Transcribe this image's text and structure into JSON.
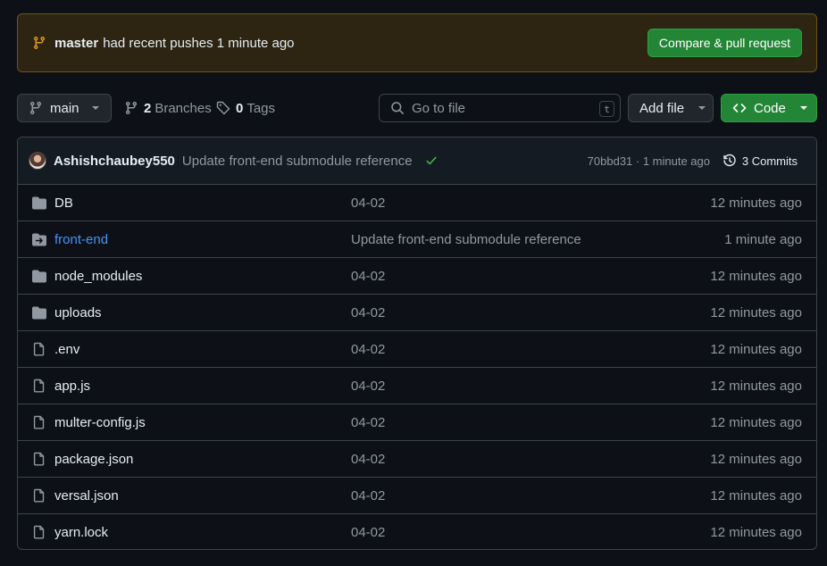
{
  "banner": {
    "branch": "master",
    "message": "had recent pushes 1 minute ago",
    "compare_label": "Compare & pull request"
  },
  "toolbar": {
    "branch_label": "main",
    "branches_count": "2",
    "branches_label": "Branches",
    "tags_count": "0",
    "tags_label": "Tags",
    "search_placeholder": "Go to file",
    "search_shortcut": "t",
    "add_file_label": "Add file",
    "code_label": "Code"
  },
  "commit": {
    "author": "Ashishchaubey550",
    "message": "Update front-end submodule reference",
    "meta": "70bbd31 · 1 minute ago",
    "commits_label": "3 Commits"
  },
  "files": [
    {
      "name": "DB",
      "type": "folder",
      "message": "04-02",
      "date": "12 minutes ago"
    },
    {
      "name": "front-end",
      "type": "submodule",
      "message": "Update front-end submodule reference",
      "date": "1 minute ago"
    },
    {
      "name": "node_modules",
      "type": "folder",
      "message": "04-02",
      "date": "12 minutes ago"
    },
    {
      "name": "uploads",
      "type": "folder",
      "message": "04-02",
      "date": "12 minutes ago"
    },
    {
      "name": ".env",
      "type": "file",
      "message": "04-02",
      "date": "12 minutes ago"
    },
    {
      "name": "app.js",
      "type": "file",
      "message": "04-02",
      "date": "12 minutes ago"
    },
    {
      "name": "multer-config.js",
      "type": "file",
      "message": "04-02",
      "date": "12 minutes ago"
    },
    {
      "name": "package.json",
      "type": "file",
      "message": "04-02",
      "date": "12 minutes ago"
    },
    {
      "name": "versal.json",
      "type": "file",
      "message": "04-02",
      "date": "12 minutes ago"
    },
    {
      "name": "yarn.lock",
      "type": "file",
      "message": "04-02",
      "date": "12 minutes ago"
    }
  ],
  "colors": {
    "background": "#0d1117",
    "accent_green": "#238636",
    "link_blue": "#4493f8",
    "banner_bg": "#2d2512",
    "warning_icon": "#d29922",
    "check_green": "#3fb950"
  }
}
